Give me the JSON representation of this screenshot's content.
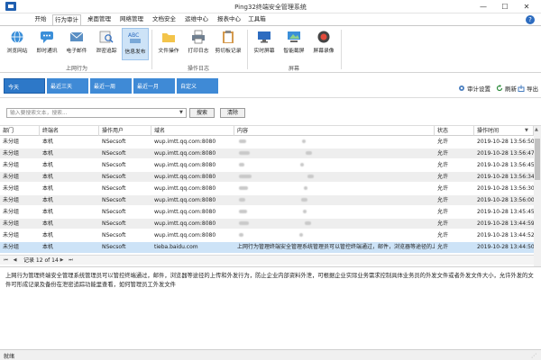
{
  "window": {
    "title": "Ping32终端安全管理系统",
    "controls": {
      "minimize": "—",
      "maximize": "☐",
      "close": "✕"
    }
  },
  "ribbon_tabs": [
    "开始",
    "行为审计",
    "桌面管理",
    "网络管理",
    "文档安全",
    "运维中心",
    "报表中心",
    "工具箱"
  ],
  "active_ribbon_tab": "行为审计",
  "help_label": "?",
  "ribbon_groups": [
    {
      "label": "上网行为",
      "buttons": [
        {
          "label": "浏览网站",
          "icon": "globe-icon"
        },
        {
          "label": "即时通讯",
          "icon": "chat-icon"
        },
        {
          "label": "电子邮件",
          "icon": "mail-icon"
        },
        {
          "label": "泄密追踪",
          "icon": "trace-icon"
        },
        {
          "label": "信息发布",
          "icon": "publish-icon",
          "selected": true
        }
      ]
    },
    {
      "label": "操作日志",
      "buttons": [
        {
          "label": "文件操作",
          "icon": "folder-icon"
        },
        {
          "label": "打印日志",
          "icon": "printer-icon"
        },
        {
          "label": "剪切板记录",
          "icon": "clipboard-icon"
        }
      ]
    },
    {
      "label": "屏幕",
      "buttons": [
        {
          "label": "实时屏幕",
          "icon": "monitor-icon"
        },
        {
          "label": "智能截屏",
          "icon": "screenshot-icon"
        },
        {
          "label": "屏幕录像",
          "icon": "record-icon"
        }
      ]
    }
  ],
  "date_filters": [
    "今天",
    "最近三天",
    "最近一周",
    "最近一月",
    "自定义"
  ],
  "active_date_filter": "今天",
  "toolbar_actions": {
    "audit_settings": "审计设置",
    "refresh": "刷新",
    "export": "导出"
  },
  "search": {
    "placeholder": "输入要搜索文本，搜索...",
    "search_button": "搜索",
    "clear_button": "清除"
  },
  "table": {
    "columns": [
      "部门",
      "终端名",
      "操作用户",
      "域名",
      "内容",
      "状态",
      "操作时间"
    ],
    "rows": [
      {
        "dept": "未分组",
        "terminal": "本机",
        "user": "NSecsoft",
        "domain": "wup.imtt.qq.com:8080",
        "content": "",
        "status": "允许",
        "time": "2019-10-28 13:56:50"
      },
      {
        "dept": "未分组",
        "terminal": "本机",
        "user": "NSecsoft",
        "domain": "wup.imtt.qq.com:8080",
        "content": "",
        "status": "允许",
        "time": "2019-10-28 13:56:47"
      },
      {
        "dept": "未分组",
        "terminal": "本机",
        "user": "NSecsoft",
        "domain": "wup.imtt.qq.com:8080",
        "content": "",
        "status": "允许",
        "time": "2019-10-28 13:56:45"
      },
      {
        "dept": "未分组",
        "terminal": "本机",
        "user": "NSecsoft",
        "domain": "wup.imtt.qq.com:8080",
        "content": "",
        "status": "允许",
        "time": "2019-10-28 13:56:34"
      },
      {
        "dept": "未分组",
        "terminal": "本机",
        "user": "NSecsoft",
        "domain": "wup.imtt.qq.com:8080",
        "content": "",
        "status": "允许",
        "time": "2019-10-28 13:56:30"
      },
      {
        "dept": "未分组",
        "terminal": "本机",
        "user": "NSecsoft",
        "domain": "wup.imtt.qq.com:8080",
        "content": "",
        "status": "允许",
        "time": "2019-10-28 13:56:00"
      },
      {
        "dept": "未分组",
        "terminal": "本机",
        "user": "NSecsoft",
        "domain": "wup.imtt.qq.com:8080",
        "content": "",
        "status": "允许",
        "time": "2019-10-28 13:45:45"
      },
      {
        "dept": "未分组",
        "terminal": "本机",
        "user": "NSecsoft",
        "domain": "wup.imtt.qq.com:8080",
        "content": "",
        "status": "允许",
        "time": "2019-10-28 13:44:59"
      },
      {
        "dept": "未分组",
        "terminal": "本机",
        "user": "NSecsoft",
        "domain": "wup.imtt.qq.com:8080",
        "content": "",
        "status": "允许",
        "time": "2019-10-28 13:44:52"
      },
      {
        "dept": "未分组",
        "terminal": "本机",
        "user": "NSecsoft",
        "domain": "tieba.baidu.com",
        "content": "上网行为管理终端安全管理系统管理员可以管控终端通过，邮件，浏览器等途径的上...",
        "status": "允许",
        "time": "2019-10-28 13:44:50",
        "selected": true
      }
    ]
  },
  "record_nav": {
    "text": "记录 12 of 14"
  },
  "detail_text": "上网行为管理终端安全管理系统管理员可以管控终端通过，邮件，浏览器等途径的上传和外发行为，防止企业内部资料外泄，可根据企业实际业务需求控制具体业务员的外发文件或者外发文件大小，允许外发的文件可形成记录及备份在泄密追踪功能里查看，如何管理员工外发文件",
  "status_bar": "就绪",
  "colors": {
    "accent": "#2d78c8",
    "selected_row": "#cde3f7",
    "alt_row": "#eeeeee"
  }
}
